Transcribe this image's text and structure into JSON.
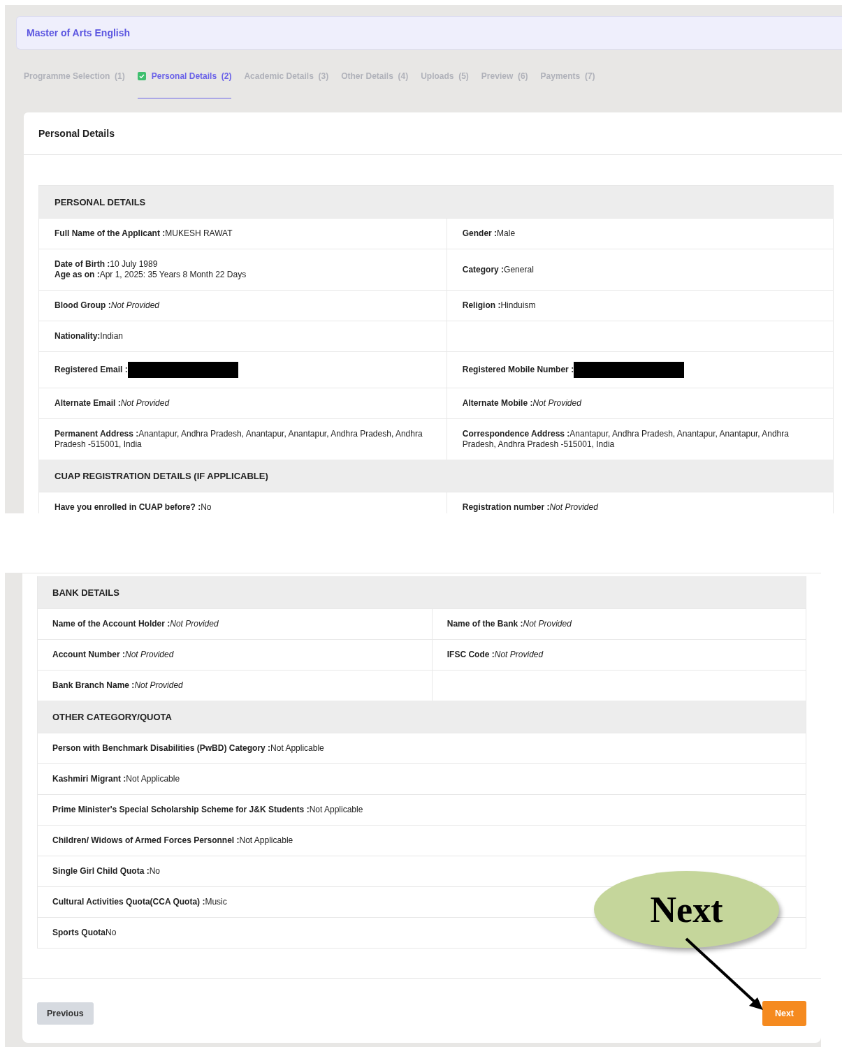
{
  "header": {
    "title": "Master of Arts English"
  },
  "steps": [
    {
      "label": "Programme Selection",
      "number": "(1)",
      "selected": false,
      "checked": false
    },
    {
      "label": "Personal Details",
      "number": "(2)",
      "selected": true,
      "checked": true
    },
    {
      "label": "Academic Details",
      "number": "(3)",
      "selected": false,
      "checked": false
    },
    {
      "label": "Other Details",
      "number": "(4)",
      "selected": false,
      "checked": false
    },
    {
      "label": "Uploads",
      "number": "(5)",
      "selected": false,
      "checked": false
    },
    {
      "label": "Preview",
      "number": "(6)",
      "selected": false,
      "checked": false
    },
    {
      "label": "Payments",
      "number": "(7)",
      "selected": false,
      "checked": false
    }
  ],
  "card_title": "Personal Details",
  "top_sections": [
    {
      "heading": "PERSONAL DETAILS",
      "kind": "grid",
      "rows": [
        {
          "cells": [
            {
              "fields": [
                {
                  "label": "Full Name of the Applicant :",
                  "value": "MUKESH RAWAT",
                  "provided": true
                }
              ]
            },
            {
              "fields": [
                {
                  "label": "Gender :",
                  "value": "Male",
                  "provided": true
                }
              ]
            }
          ]
        },
        {
          "cells": [
            {
              "fields": [
                {
                  "label": "Date of Birth :",
                  "value": "10 July 1989",
                  "provided": true
                },
                {
                  "label": "Age as on :",
                  "value": "Apr 1, 2025: 35 Years 8 Month 22 Days",
                  "provided": true
                }
              ]
            },
            {
              "fields": [
                {
                  "label": "Category :",
                  "value": "General",
                  "provided": true
                }
              ]
            }
          ]
        },
        {
          "cells": [
            {
              "fields": [
                {
                  "label": "Blood Group :",
                  "value": "Not Provided",
                  "provided": false
                }
              ]
            },
            {
              "fields": [
                {
                  "label": "Religion :",
                  "value": "Hinduism",
                  "provided": true
                }
              ]
            }
          ]
        },
        {
          "cells": [
            {
              "fields": [
                {
                  "label": "Nationality:",
                  "value": "Indian",
                  "provided": true
                }
              ]
            }
          ]
        },
        {
          "cells": [
            {
              "fields": [
                {
                  "label": "Registered Email :",
                  "redacted": true
                }
              ]
            },
            {
              "fields": [
                {
                  "label": "Registered Mobile Number :",
                  "redacted": true
                }
              ]
            }
          ]
        },
        {
          "cells": [
            {
              "fields": [
                {
                  "label": "Alternate Email :",
                  "value": "Not Provided",
                  "provided": false
                }
              ]
            },
            {
              "fields": [
                {
                  "label": "Alternate Mobile :",
                  "value": "Not Provided",
                  "provided": false
                }
              ]
            }
          ]
        },
        {
          "cells": [
            {
              "fields": [
                {
                  "label": "Permanent Address :",
                  "value": "Anantapur, Andhra Pradesh, Anantapur, Anantapur, Andhra Pradesh, Andhra Pradesh -515001, India",
                  "provided": true
                }
              ]
            },
            {
              "fields": [
                {
                  "label": "Correspondence Address :",
                  "value": "Anantapur, Andhra Pradesh, Anantapur, Anantapur, Andhra Pradesh, Andhra Pradesh -515001, India",
                  "provided": true
                }
              ]
            }
          ]
        }
      ]
    },
    {
      "heading": "CUAP REGISTRATION DETAILS (IF APPLICABLE)",
      "kind": "grid",
      "rows": [
        {
          "cells": [
            {
              "fields": [
                {
                  "label": "Have you enrolled in CUAP before? :",
                  "value": "No",
                  "provided": true
                }
              ]
            },
            {
              "fields": [
                {
                  "label": "Registration number :",
                  "value": "Not Provided",
                  "provided": false
                }
              ]
            }
          ]
        }
      ]
    }
  ],
  "bottom_sections": [
    {
      "heading": "BANK DETAILS",
      "kind": "grid",
      "rows": [
        {
          "cells": [
            {
              "fields": [
                {
                  "label": "Name of the Account Holder :",
                  "value": "Not Provided",
                  "provided": false
                }
              ]
            },
            {
              "fields": [
                {
                  "label": "Name of the Bank :",
                  "value": "Not Provided",
                  "provided": false
                }
              ]
            }
          ]
        },
        {
          "cells": [
            {
              "fields": [
                {
                  "label": "Account Number :",
                  "value": "Not Provided",
                  "provided": false
                }
              ]
            },
            {
              "fields": [
                {
                  "label": "IFSC Code :",
                  "value": "Not Provided",
                  "provided": false
                }
              ]
            }
          ]
        },
        {
          "cells": [
            {
              "fields": [
                {
                  "label": "Bank Branch Name :",
                  "value": "Not Provided",
                  "provided": false
                }
              ]
            }
          ]
        }
      ]
    },
    {
      "heading": "OTHER CATEGORY/QUOTA",
      "kind": "list",
      "rows": [
        {
          "cells": [
            {
              "fields": [
                {
                  "label": "Person with Benchmark Disabilities (PwBD) Category :",
                  "value": "Not Applicable",
                  "provided": true
                }
              ]
            }
          ]
        },
        {
          "cells": [
            {
              "fields": [
                {
                  "label": "Kashmiri Migrant :",
                  "value": "Not Applicable",
                  "provided": true
                }
              ]
            }
          ]
        },
        {
          "cells": [
            {
              "fields": [
                {
                  "label": "Prime Minister's Special Scholarship Scheme for J&K Students :",
                  "value": "Not Applicable",
                  "provided": true
                }
              ]
            }
          ]
        },
        {
          "cells": [
            {
              "fields": [
                {
                  "label": "Children/ Widows of Armed Forces Personnel :",
                  "value": "Not Applicable",
                  "provided": true
                }
              ]
            }
          ]
        },
        {
          "cells": [
            {
              "fields": [
                {
                  "label": "Single Girl Child Quota :",
                  "value": "No",
                  "provided": true
                }
              ]
            }
          ]
        },
        {
          "cells": [
            {
              "fields": [
                {
                  "label": "Cultural Activities Quota(CCA Quota) :",
                  "value": "Music",
                  "provided": true
                }
              ]
            }
          ]
        },
        {
          "cells": [
            {
              "fields": [
                {
                  "label": "Sports Quota",
                  "value": "No",
                  "provided": true
                }
              ]
            }
          ]
        }
      ]
    }
  ],
  "buttons": [
    {
      "label": "Previous",
      "kind": "secondary"
    },
    {
      "label": "Next",
      "kind": "primary"
    }
  ],
  "annotation": {
    "text": "Next"
  }
}
